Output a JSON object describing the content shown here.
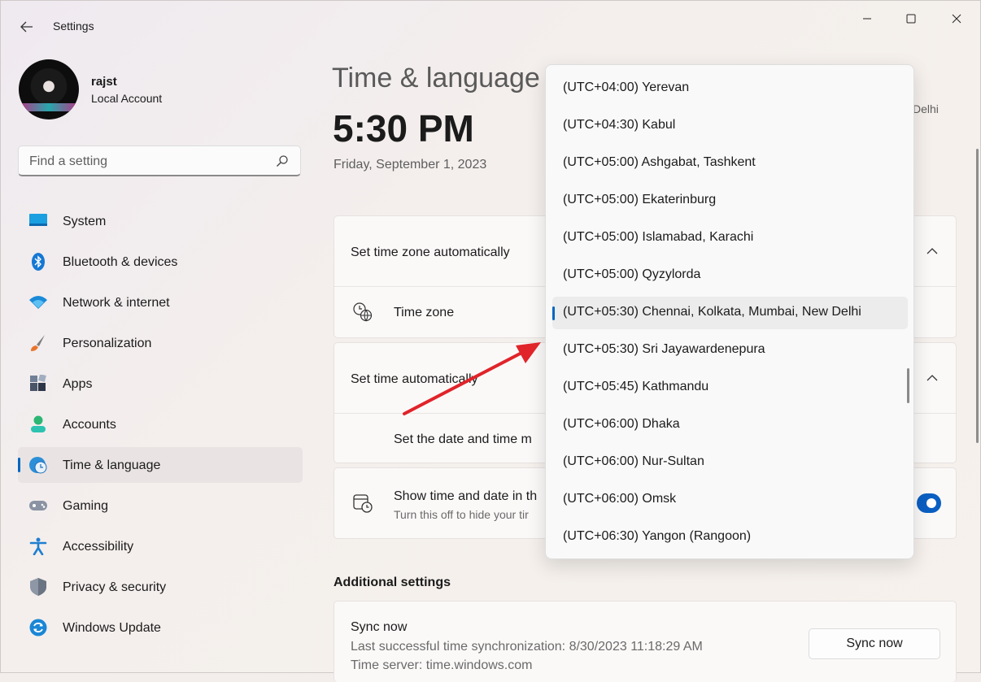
{
  "app": {
    "title": "Settings"
  },
  "user": {
    "name": "rajst",
    "account_type": "Local Account"
  },
  "search": {
    "placeholder": "Find a setting"
  },
  "nav": [
    {
      "label": "System",
      "icon": "system-icon"
    },
    {
      "label": "Bluetooth & devices",
      "icon": "bluetooth-icon"
    },
    {
      "label": "Network & internet",
      "icon": "wifi-icon"
    },
    {
      "label": "Personalization",
      "icon": "brush-icon"
    },
    {
      "label": "Apps",
      "icon": "apps-icon"
    },
    {
      "label": "Accounts",
      "icon": "person-icon"
    },
    {
      "label": "Time & language",
      "icon": "globe-clock-icon",
      "active": true
    },
    {
      "label": "Gaming",
      "icon": "gamepad-icon"
    },
    {
      "label": "Accessibility",
      "icon": "accessibility-icon"
    },
    {
      "label": "Privacy & security",
      "icon": "shield-icon"
    },
    {
      "label": "Windows Update",
      "icon": "update-icon"
    }
  ],
  "main": {
    "title": "Time & language",
    "time": "5:30 PM",
    "date": "Friday, September 1, 2023",
    "tz_hint": "Delhi",
    "set_timezone_auto": "Set time zone automatically",
    "timezone_label": "Time zone",
    "set_time_auto": "Set time automatically",
    "set_date_time_manually": "Set the date and time m",
    "show_time_title": "Show time and date in th",
    "show_time_sub": "Turn this off to hide your tir",
    "additional_settings": "Additional settings",
    "sync_title": "Sync now",
    "sync_last": "Last successful time synchronization: 8/30/2023 11:18:29 AM",
    "time_server": "Time server: time.windows.com",
    "sync_button": "Sync now"
  },
  "dropdown": {
    "options": [
      "(UTC+04:00) Yerevan",
      "(UTC+04:30) Kabul",
      "(UTC+05:00) Ashgabat, Tashkent",
      "(UTC+05:00) Ekaterinburg",
      "(UTC+05:00) Islamabad, Karachi",
      "(UTC+05:00) Qyzylorda",
      "(UTC+05:30) Chennai, Kolkata, Mumbai, New Delhi",
      "(UTC+05:30) Sri Jayawardenepura",
      "(UTC+05:45) Kathmandu",
      "(UTC+06:00) Dhaka",
      "(UTC+06:00) Nur-Sultan",
      "(UTC+06:00) Omsk",
      "(UTC+06:30) Yangon (Rangoon)"
    ],
    "selected_index": 6
  },
  "colors": {
    "accent": "#0067c0",
    "annotation_arrow": "#e0242a"
  }
}
